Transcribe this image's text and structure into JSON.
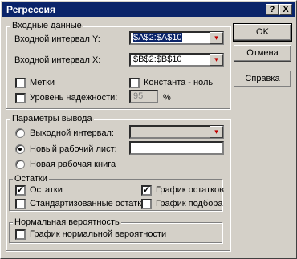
{
  "window": {
    "title": "Регрессия",
    "help_btn": "?",
    "close_btn": "X"
  },
  "input_group": {
    "title": "Входные данные",
    "y_label": "Входной интервал Y:",
    "y_value": "$A$2:$A$10",
    "x_label": "Входной интервал X:",
    "x_value": "$B$2:$B$10",
    "labels_cb": "Метки",
    "const_cb": "Константа - ноль",
    "confidence_cb": "Уровень надежности:",
    "confidence_value": "95",
    "percent": "%"
  },
  "output_group": {
    "title": "Параметры вывода",
    "out_range": "Выходной интервал:",
    "new_sheet": "Новый рабочий лист:",
    "new_book": "Новая рабочая книга"
  },
  "residuals_group": {
    "title": "Остатки",
    "residuals": "Остатки",
    "std_residuals": "Стандартизованные остатки",
    "residual_plot": "График остатков",
    "fit_plot": "График подбора"
  },
  "normal_group": {
    "title": "Нормальная вероятность",
    "normal_plot": "График нормальной вероятности"
  },
  "buttons": {
    "ok": "OK",
    "cancel": "Отмена",
    "help": "Справка"
  },
  "state": {
    "residuals_checked": true,
    "residual_plot_checked": true,
    "selected_output": "new_sheet"
  }
}
